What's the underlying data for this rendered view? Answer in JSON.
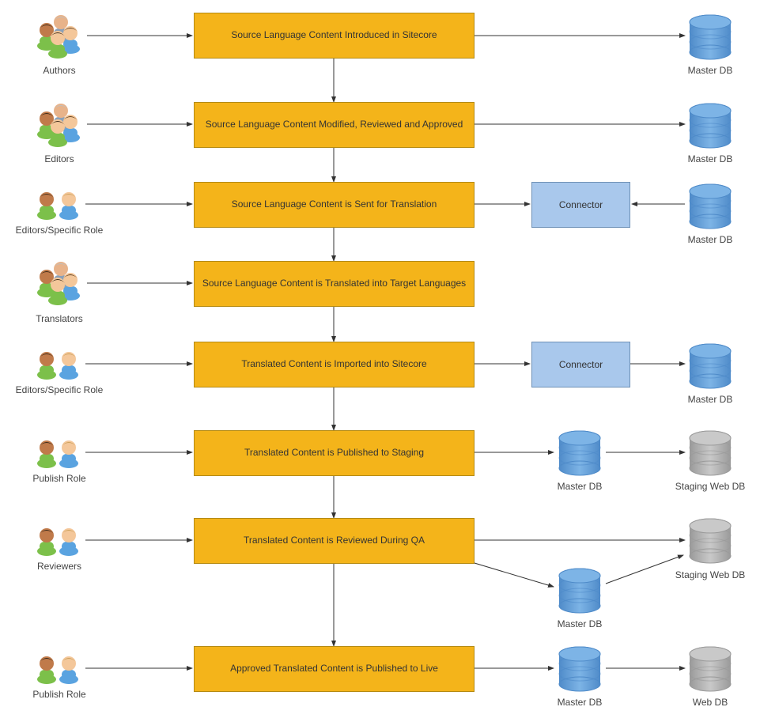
{
  "steps": [
    {
      "label": "Source Language Content Introduced in Sitecore"
    },
    {
      "label": "Source Language Content Modified, Reviewed and Approved"
    },
    {
      "label": "Source Language Content is Sent for Translation"
    },
    {
      "label": "Source Language Content is Translated into Target Languages"
    },
    {
      "label": "Translated Content is Imported into Sitecore"
    },
    {
      "label": "Translated Content is Published to Staging"
    },
    {
      "label": "Translated Content is Reviewed During QA"
    },
    {
      "label": "Approved Translated Content is Published to Live"
    }
  ],
  "actors": [
    {
      "label": "Authors",
      "type": "group"
    },
    {
      "label": "Editors",
      "type": "group"
    },
    {
      "label": "Editors/Specific Role",
      "type": "pair"
    },
    {
      "label": "Translators",
      "type": "group"
    },
    {
      "label": "Editors/Specific Role",
      "type": "pair"
    },
    {
      "label": "Publish Role",
      "type": "pair"
    },
    {
      "label": "Reviewers",
      "type": "pair"
    },
    {
      "label": "Publish Role",
      "type": "pair"
    }
  ],
  "connectors": {
    "row3": "Connector",
    "row5": "Connector"
  },
  "db_labels": {
    "master": "Master DB",
    "staging": "Staging Web DB",
    "web": "Web DB"
  },
  "colors": {
    "process_fill": "#f4b41a",
    "process_border": "#b48a14",
    "connector_fill": "#a9c8ec",
    "connector_border": "#6f91b6",
    "db_blue_top": "#7db4e6",
    "db_blue_side": "#4f8bc9",
    "db_grey_top": "#c9c9c9",
    "db_grey_side": "#9a9a9a"
  }
}
